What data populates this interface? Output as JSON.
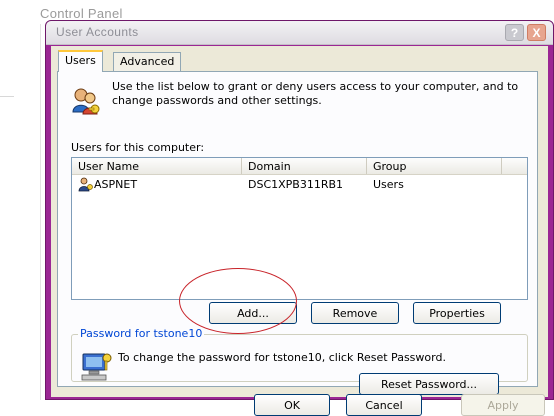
{
  "background": {
    "title": "Control Panel"
  },
  "window": {
    "title": "User Accounts",
    "help_button": "?",
    "close_button": "X"
  },
  "tabs": [
    {
      "label": "Users",
      "selected": true
    },
    {
      "label": "Advanced",
      "selected": false
    }
  ],
  "users_tab": {
    "intro_text": "Use the list below to grant or deny users access to your computer, and to change passwords and other settings.",
    "users_label": "Users for this computer:",
    "columns": [
      "User Name",
      "Domain",
      "Group"
    ],
    "rows": [
      {
        "user_name": "ASPNET",
        "domain": "DSC1XPB311RB1",
        "group": "Users"
      }
    ],
    "buttons": {
      "add": "Add...",
      "remove": "Remove",
      "properties": "Properties"
    },
    "password_group": {
      "label": "Password for tstone10",
      "text": "To change the password for tstone10, click Reset Password.",
      "reset_button": "Reset Password..."
    }
  },
  "dialog_buttons": {
    "ok": "OK",
    "cancel": "Cancel",
    "apply": "Apply",
    "apply_enabled": false
  },
  "colors": {
    "frame": "#9b2694",
    "highlight_circle": "#c8242a",
    "group_label": "#0046d5"
  },
  "icons": [
    "users-key-icon",
    "user-row-icon",
    "computer-key-icon",
    "help-icon",
    "close-icon"
  ]
}
